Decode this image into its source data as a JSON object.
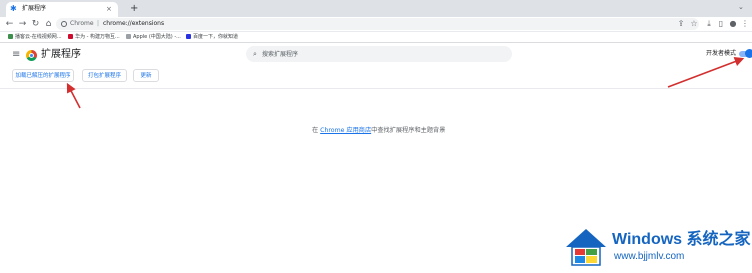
{
  "tab": {
    "title": "扩展程序",
    "close": "×",
    "new_tab": "+"
  },
  "toolbar": {
    "back": "←",
    "forward": "→",
    "reload": "C",
    "home": "⌂",
    "omnibox_label": "Chrome",
    "omnibox_sep": "|",
    "url": "chrome://extensions"
  },
  "bookmarks": [
    {
      "label": "播客云-在线视频网...",
      "color": "#3c8f4d"
    },
    {
      "label": "华为 - 构建万物互...",
      "color": "#cf0a2c"
    },
    {
      "label": "Apple (中国大陆) -...",
      "color": "#9aa0a6"
    },
    {
      "label": "百度一下，你就知道",
      "color": "#2932e1"
    }
  ],
  "header": {
    "title": "扩展程序",
    "search_placeholder": "搜索扩展程序",
    "dev_mode_label": "开发者模式",
    "dev_mode_on": true
  },
  "actions": {
    "load_unpacked": "加载已解压的扩展程序",
    "pack": "打包扩展程序",
    "update": "更新"
  },
  "empty": {
    "prefix": "在 ",
    "link": "Chrome 应用商店",
    "suffix": "中查找扩展程序和主题背景"
  },
  "watermark": {
    "title": "Windows 系统之家",
    "url": "www.bjjmlv.com"
  },
  "colors": {
    "accent": "#1a73e8",
    "arrow": "#d32f2f"
  }
}
